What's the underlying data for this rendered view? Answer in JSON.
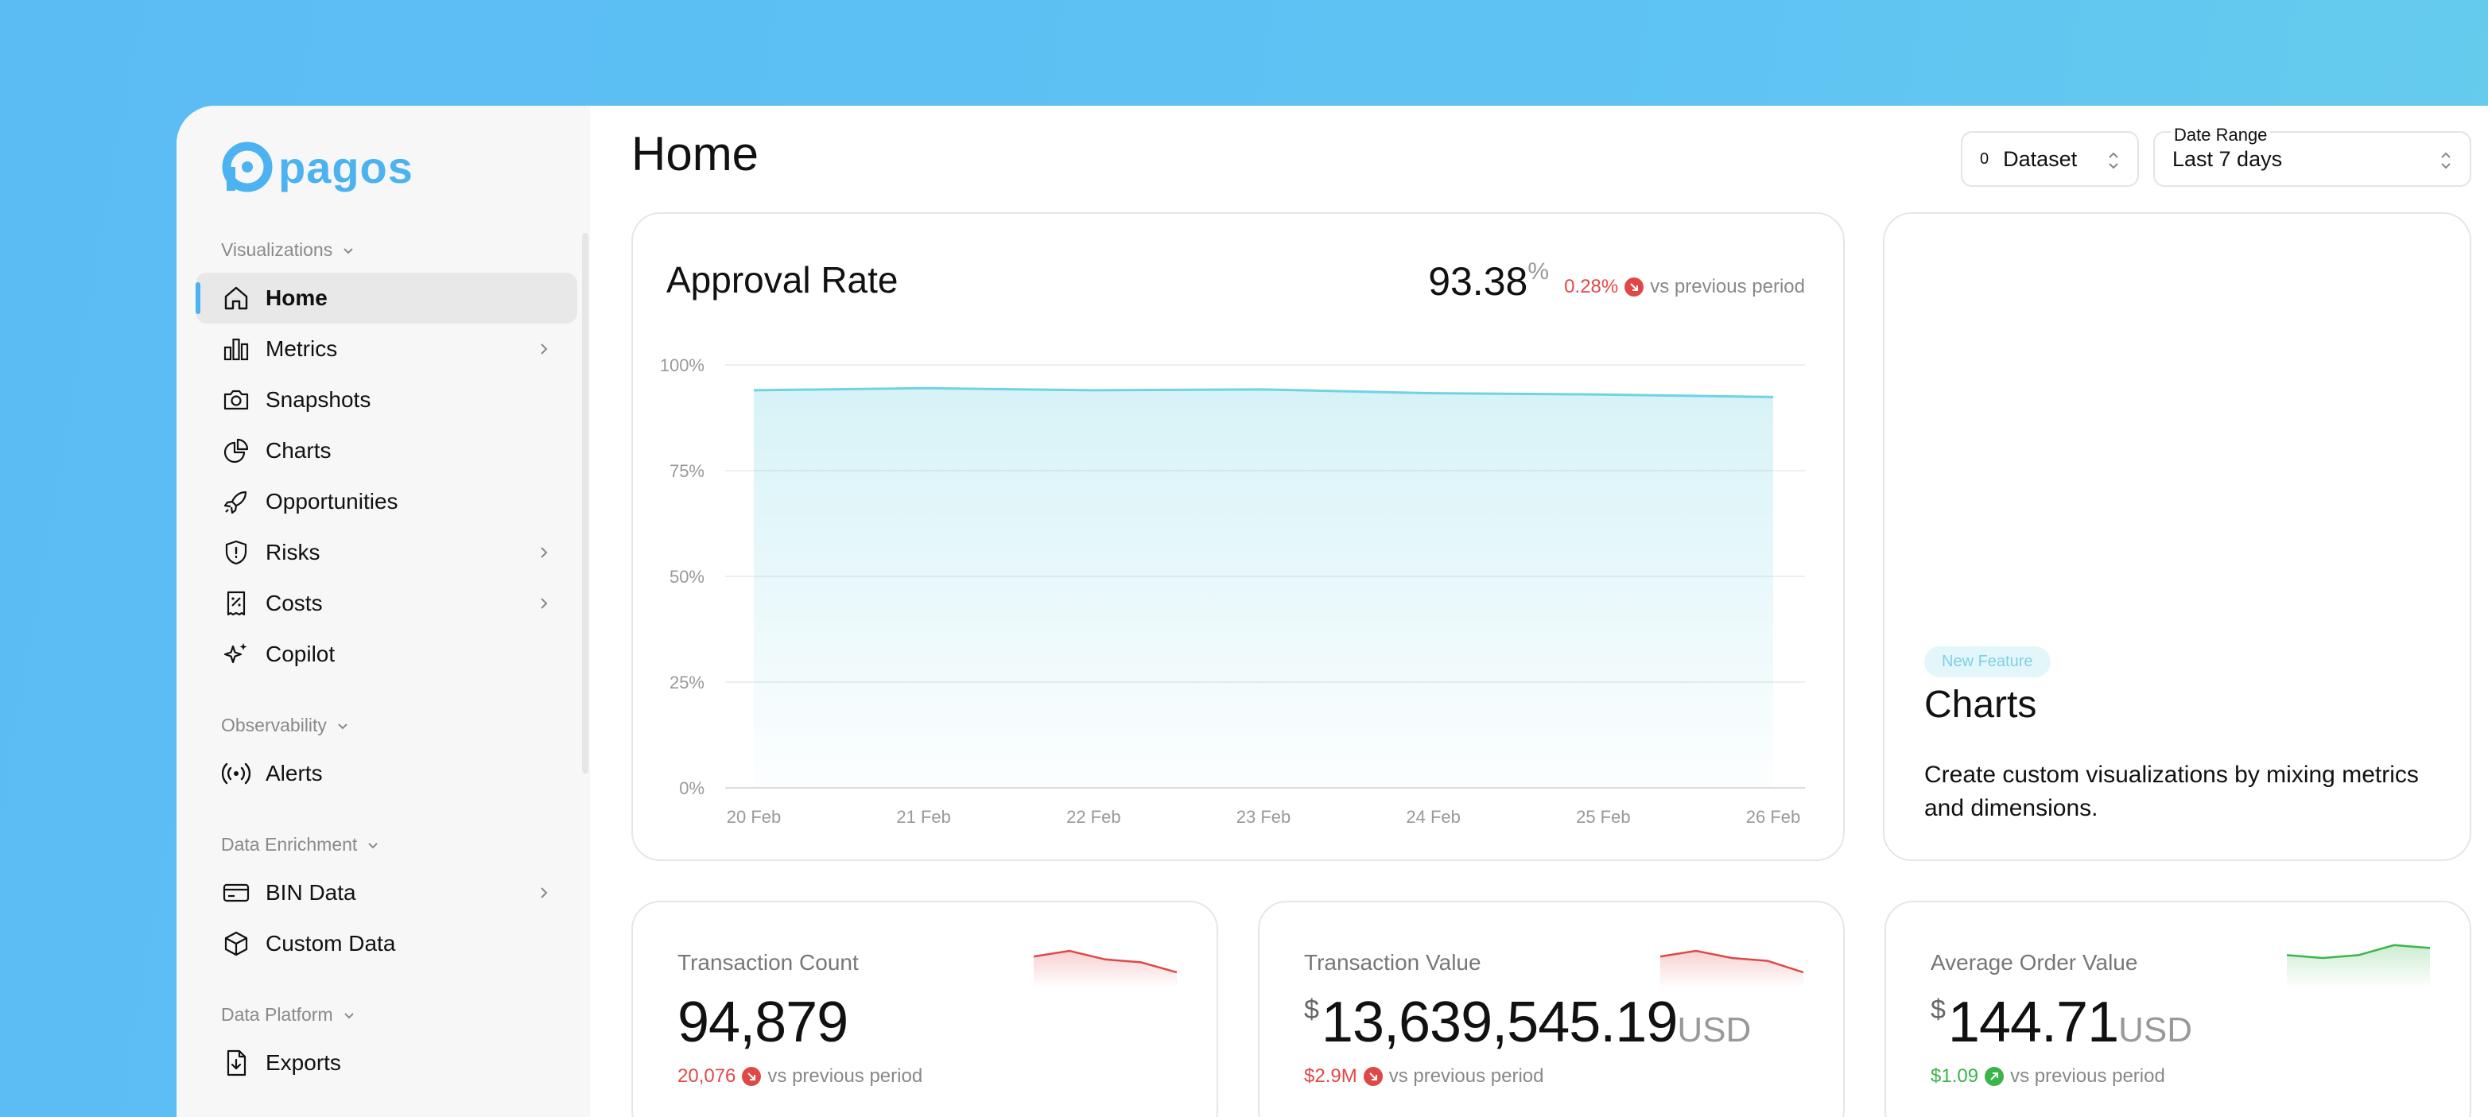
{
  "brand": {
    "name": "pagos",
    "color": "#4db3f0"
  },
  "sidebar": {
    "sections": [
      {
        "title": "Visualizations",
        "items": [
          {
            "label": "Home",
            "icon": "home-icon",
            "active": true,
            "chevron": false
          },
          {
            "label": "Metrics",
            "icon": "bar-chart-icon",
            "chevron": true
          },
          {
            "label": "Snapshots",
            "icon": "camera-icon",
            "chevron": false
          },
          {
            "label": "Charts",
            "icon": "pie-chart-icon",
            "chevron": false
          },
          {
            "label": "Opportunities",
            "icon": "rocket-icon",
            "chevron": false
          },
          {
            "label": "Risks",
            "icon": "shield-icon",
            "chevron": true
          },
          {
            "label": "Costs",
            "icon": "receipt-icon",
            "chevron": true
          },
          {
            "label": "Copilot",
            "icon": "sparkles-icon",
            "chevron": false
          }
        ]
      },
      {
        "title": "Observability",
        "items": [
          {
            "label": "Alerts",
            "icon": "broadcast-icon",
            "chevron": false
          }
        ]
      },
      {
        "title": "Data Enrichment",
        "items": [
          {
            "label": "BIN Data",
            "icon": "credit-card-icon",
            "chevron": true
          },
          {
            "label": "Custom Data",
            "icon": "box-icon",
            "chevron": false
          }
        ]
      },
      {
        "title": "Data Platform",
        "items": [
          {
            "label": "Exports",
            "icon": "file-export-icon",
            "chevron": false
          }
        ]
      }
    ]
  },
  "header": {
    "title": "Home",
    "dataset": {
      "count": "0",
      "label": "Dataset"
    },
    "date_range": {
      "label": "Date Range",
      "value": "Last 7 days"
    }
  },
  "approval": {
    "title": "Approval Rate",
    "value": "93.38",
    "unit": "%",
    "delta": "0.28%",
    "delta_direction": "down",
    "delta_suffix": "vs previous period"
  },
  "chart_data": {
    "type": "area",
    "title": "Approval Rate",
    "x": [
      "20 Feb",
      "21 Feb",
      "22 Feb",
      "23 Feb",
      "24 Feb",
      "25 Feb",
      "26 Feb"
    ],
    "series": [
      {
        "values": [
          94.0,
          94.5,
          94.0,
          94.2,
          93.3,
          93.0,
          92.4
        ]
      }
    ],
    "ylim": [
      0,
      100
    ],
    "yticks": [
      "0%",
      "25%",
      "50%",
      "75%",
      "100%"
    ],
    "grid": true,
    "color": "#6fd3e3"
  },
  "feature": {
    "badge": "New Feature",
    "title": "Charts",
    "description": "Create custom visualizations by mixing metrics and dimensions."
  },
  "metrics": [
    {
      "label": "Transaction Count",
      "currency": "",
      "value": "94,879",
      "unit": "",
      "delta": "20,076",
      "direction": "down",
      "suffix": "vs previous period",
      "spark": [
        0.55,
        0.75,
        0.45,
        0.35,
        0.0
      ],
      "color": "#e04848"
    },
    {
      "label": "Transaction Value",
      "currency": "$",
      "value": "13,639,545.19",
      "unit": "USD",
      "delta": "$2.9M",
      "direction": "down",
      "suffix": "vs previous period",
      "spark": [
        0.55,
        0.75,
        0.5,
        0.4,
        0.0
      ],
      "color": "#e04848"
    },
    {
      "label": "Average Order Value",
      "currency": "$",
      "value": "144.71",
      "unit": "USD",
      "delta": "$1.09",
      "direction": "up",
      "suffix": "vs previous period",
      "spark": [
        0.6,
        0.5,
        0.6,
        0.95,
        0.85
      ],
      "color": "#3ab54a"
    }
  ]
}
